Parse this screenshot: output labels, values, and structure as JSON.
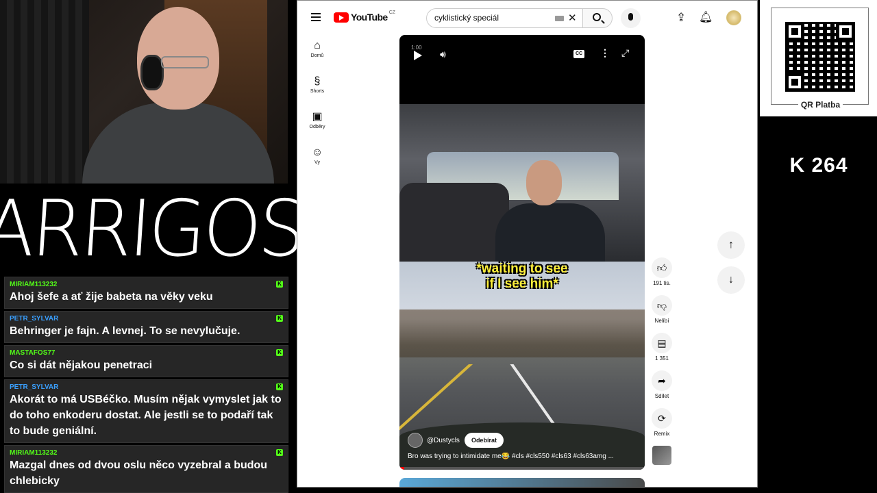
{
  "overlay": {
    "logo_text": "ARRIGOS",
    "counter": "K 264",
    "qr_label": "QR Platba"
  },
  "chat": [
    {
      "user": "MIRIAM113232",
      "color": "#53fc18",
      "text": "Ahoj šefe a ať žije babeta na věky veku"
    },
    {
      "user": "PETR_SYLVAR",
      "color": "#3aa0ff",
      "text": "Behringer je fajn. A levnej. To se nevylučuje."
    },
    {
      "user": "MASTAFOS77",
      "color": "#53fc18",
      "text": "Co si dát nějakou penetraci"
    },
    {
      "user": "PETR_SYLVAR",
      "color": "#3aa0ff",
      "text": "Akorát to má USBéčko. Musím nějak vymyslet jak to do toho enkoderu dostat. Ale jestli se to podaří tak to bude geniální."
    },
    {
      "user": "MIRIAM113232",
      "color": "#53fc18",
      "text": "Mazgal dnes od dvou oslu něco vyzebral a budou chlebicky"
    }
  ],
  "youtube": {
    "logo_text": "YouTube",
    "country": "CZ",
    "search_value": "cyklistický speciál",
    "nav": [
      {
        "label": "Domů",
        "icon": "home-icon"
      },
      {
        "label": "Shorts",
        "icon": "shorts-icon"
      },
      {
        "label": "Odběry",
        "icon": "subscriptions-icon"
      },
      {
        "label": "Vy",
        "icon": "you-icon"
      }
    ],
    "player": {
      "time": "1:00",
      "cc_label": "CC",
      "caption_line1": "*waiting to see",
      "caption_line2": "if I see him*",
      "channel": "@Dustycls",
      "subscribe_label": "Odebírat",
      "title": "Bro was trying to intimidate me😂 #cls #cls550 #cls63 #cls63amg ...",
      "progress": 0.02
    },
    "actions": {
      "likes": "191 tis.",
      "dislike_label": "Nelíbí",
      "comments": "1 351",
      "share_label": "Sdílet",
      "remix_label": "Remix"
    }
  }
}
